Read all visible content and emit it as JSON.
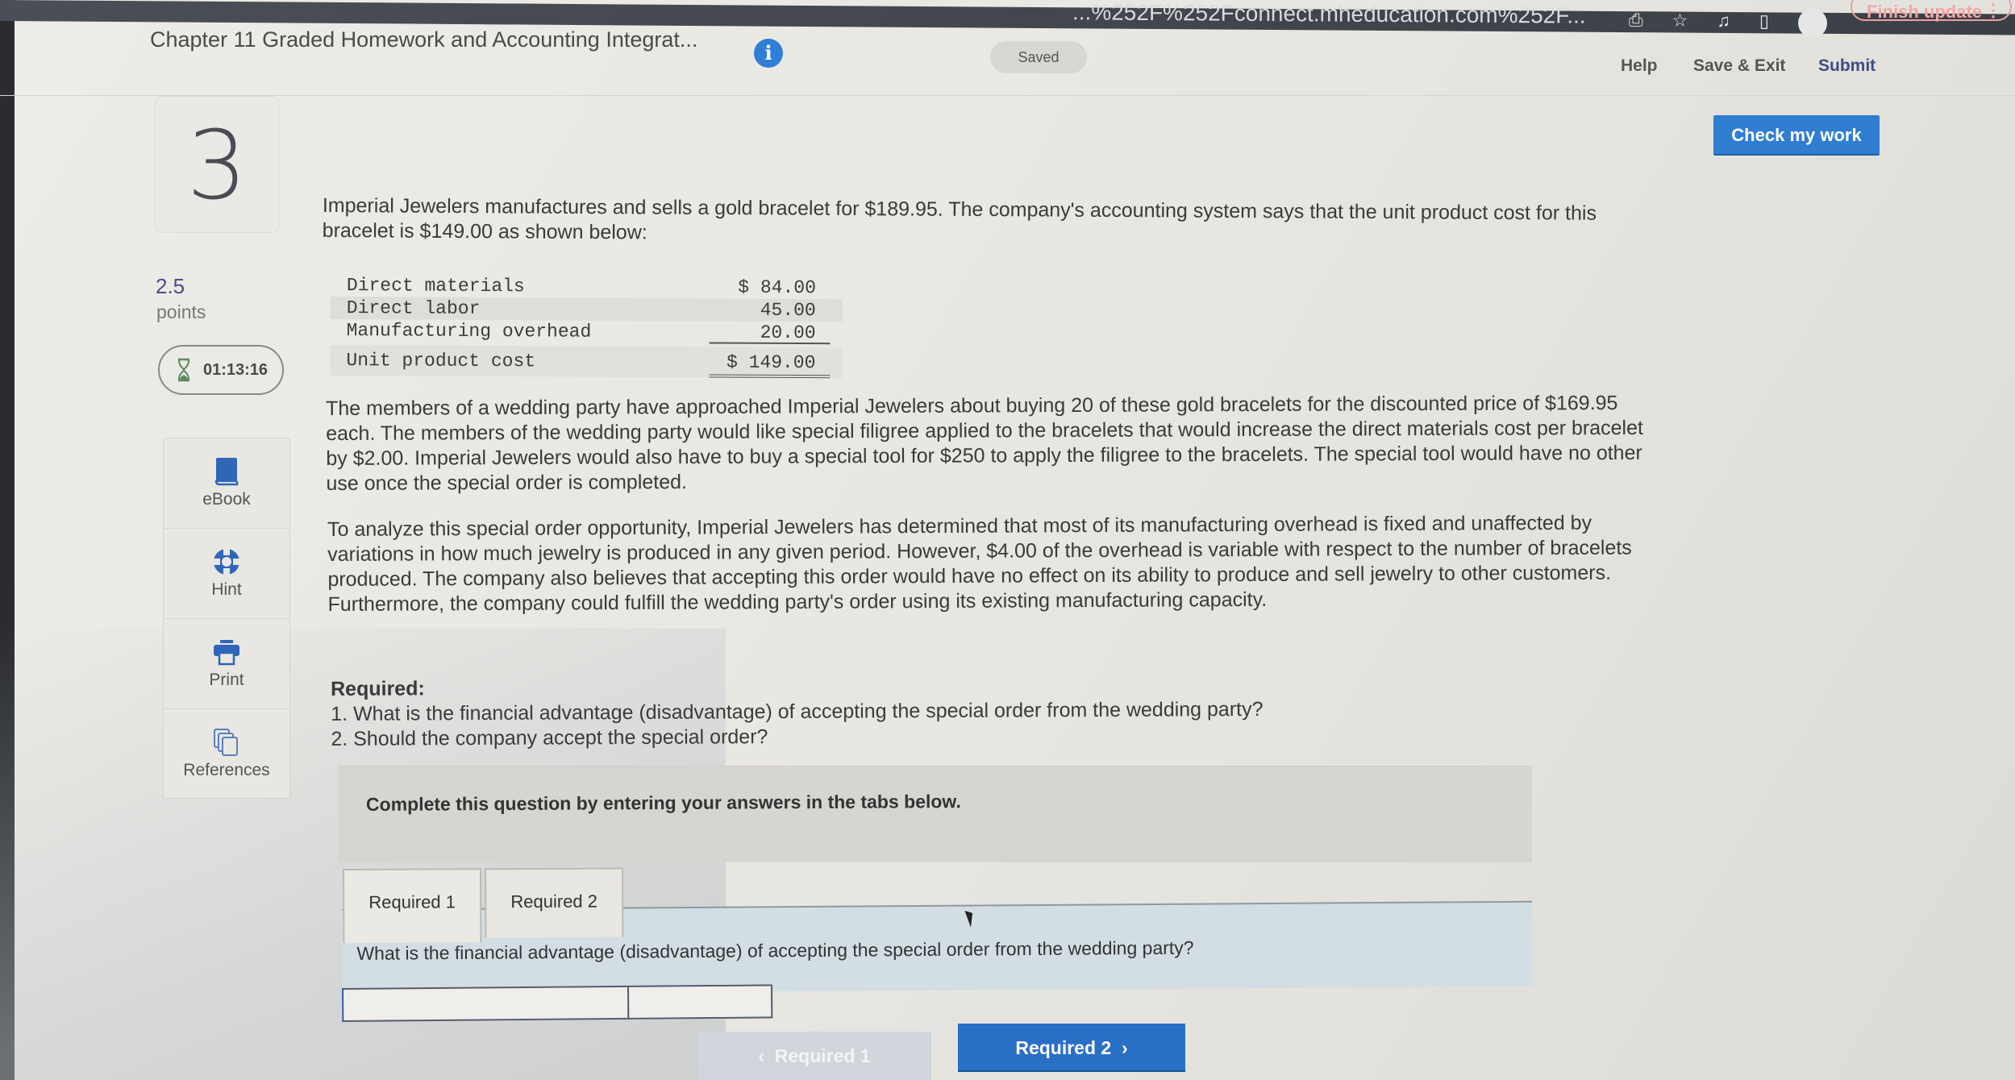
{
  "browser": {
    "url_fragment": "...%252F%252Fconnect.mheducation.com%252F...",
    "finish_update_label": "Finish update",
    "menu_icon": "⋮"
  },
  "header": {
    "title": "Chapter 11 Graded Homework and Accounting Integrat...",
    "info_icon": "i",
    "saved_status": "Saved",
    "links": {
      "help": "Help",
      "save_exit": "Save & Exit",
      "submit": "Submit"
    },
    "check_button": "Check my work"
  },
  "question_panel": {
    "number": "3",
    "points_value": "2.5",
    "points_label": "points",
    "timer": "01:13:16",
    "tools": [
      {
        "label": "eBook",
        "icon": "book-icon"
      },
      {
        "label": "Hint",
        "icon": "lifebuoy-icon"
      },
      {
        "label": "Print",
        "icon": "printer-icon"
      },
      {
        "label": "References",
        "icon": "documents-icon"
      }
    ]
  },
  "problem": {
    "intro": "Imperial Jewelers manufactures and sells a gold bracelet for $189.95. The company's accounting system says that the unit product cost for this bracelet is $149.00 as shown below:",
    "cost_table": [
      {
        "label": "Direct materials",
        "amount": "$ 84.00"
      },
      {
        "label": "Direct labor",
        "amount": "45.00"
      },
      {
        "label": "Manufacturing overhead",
        "amount": "20.00"
      },
      {
        "label": "Unit product cost",
        "amount": "$ 149.00"
      }
    ],
    "paragraph2": "The members of a wedding party have approached Imperial Jewelers about buying 20 of these gold bracelets for the discounted price of $169.95 each. The members of the wedding party would like special filigree applied to the bracelets that would increase the direct materials cost per bracelet by $2.00. Imperial Jewelers would also have to buy a special tool for $250 to apply the filigree to the bracelets. The special tool would have no other use once the special order is completed.",
    "paragraph3": "To analyze this special order opportunity, Imperial Jewelers has determined that most of its manufacturing overhead is fixed and unaffected by variations in how much jewelry is produced in any given period. However, $4.00 of the overhead is variable with respect to the number of bracelets produced. The company also believes that accepting this order would have no effect on its ability to produce and sell jewelry to other customers. Furthermore, the company could fulfill the wedding party's order using its existing manufacturing capacity.",
    "required_title": "Required:",
    "required_items": [
      "1. What is the financial advantage (disadvantage) of accepting the special order from the wedding party?",
      "2. Should the company accept the special order?"
    ]
  },
  "answer_area": {
    "instruction": "Complete this question by entering your answers in the tabs below.",
    "tabs": [
      {
        "label": "Required 1",
        "active": true
      },
      {
        "label": "Required 2",
        "active": false
      }
    ],
    "question": "What is the financial advantage (disadvantage) of accepting the special order from the wedding party?",
    "inputs": {
      "label_value": "",
      "amount_value": ""
    },
    "prev_button": "Required 1",
    "next_button": "Required 2"
  },
  "colors": {
    "accent_blue": "#2f7ed1",
    "submit_link": "#3c4c86",
    "question_bar": "#d2dee3",
    "finish_update": "#f0a6a6"
  }
}
